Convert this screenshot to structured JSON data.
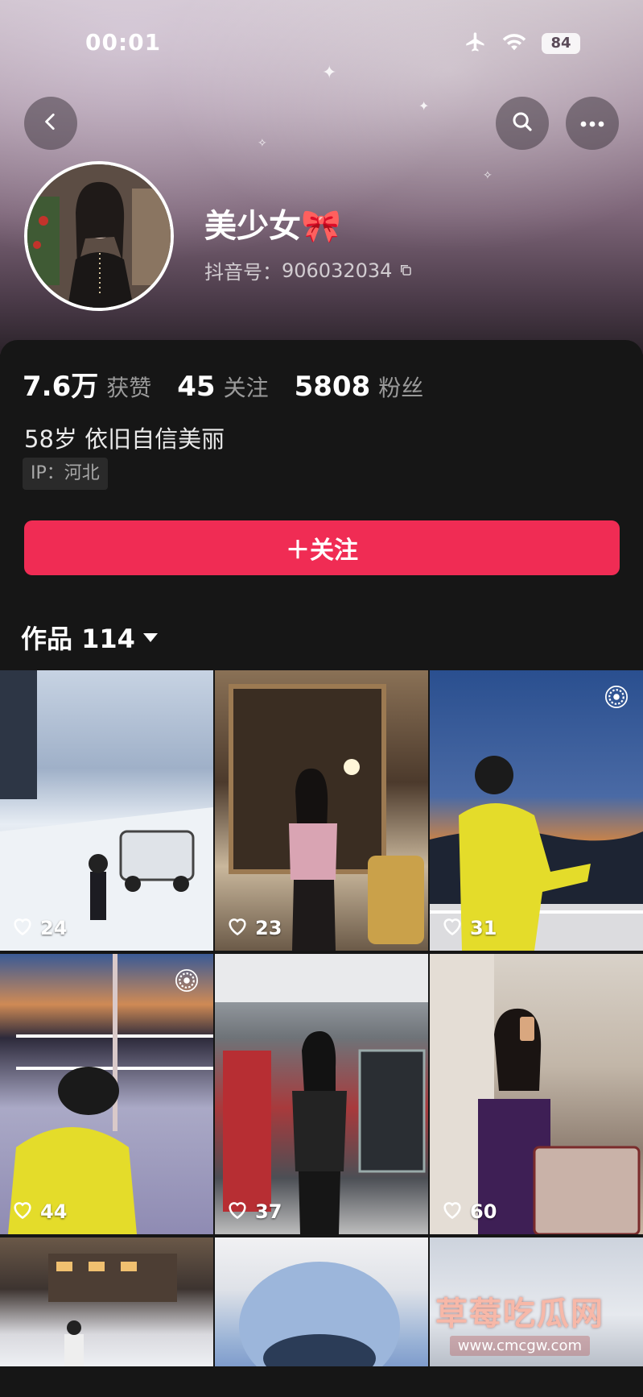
{
  "status_bar": {
    "time": "00:01",
    "battery": "84"
  },
  "profile": {
    "nickname": "美少女",
    "nickname_emoji": "🎀",
    "douyin_id_label": "抖音号：",
    "douyin_id": "906032034",
    "bio": "58岁 依旧自信美丽",
    "ip": "IP：河北"
  },
  "stats": {
    "likes_value": "7.6万",
    "likes_label": "获赞",
    "following_value": "45",
    "following_label": "关注",
    "followers_value": "5808",
    "followers_label": "粉丝"
  },
  "follow_button": {
    "label": "＋关注"
  },
  "works_tab": {
    "label": "作品 114"
  },
  "videos": [
    {
      "likes": "24",
      "live": false
    },
    {
      "likes": "23",
      "live": false
    },
    {
      "likes": "31",
      "live": true
    },
    {
      "likes": "44",
      "live": true
    },
    {
      "likes": "37",
      "live": false
    },
    {
      "likes": "60",
      "live": false
    }
  ],
  "watermark": {
    "title": "草莓吃瓜网",
    "url": "www.cmcgw.com"
  },
  "colors": {
    "accent": "#f02c54",
    "background": "#161616"
  },
  "icons": [
    "back-icon",
    "search-icon",
    "more-icon",
    "airplane-icon",
    "wifi-icon",
    "copy-icon",
    "heart-icon",
    "live-icon",
    "caret-down-icon"
  ]
}
